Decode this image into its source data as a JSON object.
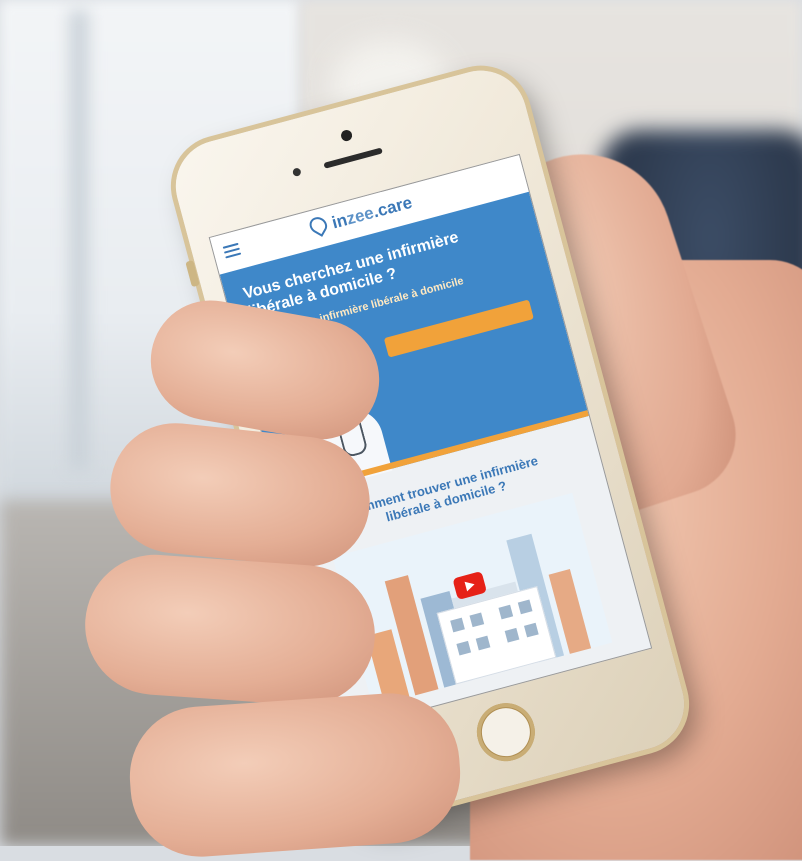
{
  "site": {
    "logo": {
      "prefix": "in",
      "mid": "zee",
      "suffix": ".care"
    },
    "tagline": ""
  },
  "hero": {
    "title": "Vous cherchez une infirmière libérale à domicile ?",
    "subtitle": "Trouvez une infirmière libérale à domicile avec inzee.care",
    "cta_label": "",
    "note": ""
  },
  "section": {
    "title": "Comment trouver une infirmière libérale à domicile ?"
  },
  "video": {
    "play_icon": "play-icon"
  },
  "colors": {
    "primary": "#3f88c9",
    "accent": "#f1a23a",
    "heading": "#3b78b7",
    "video_play": "#e62117"
  }
}
